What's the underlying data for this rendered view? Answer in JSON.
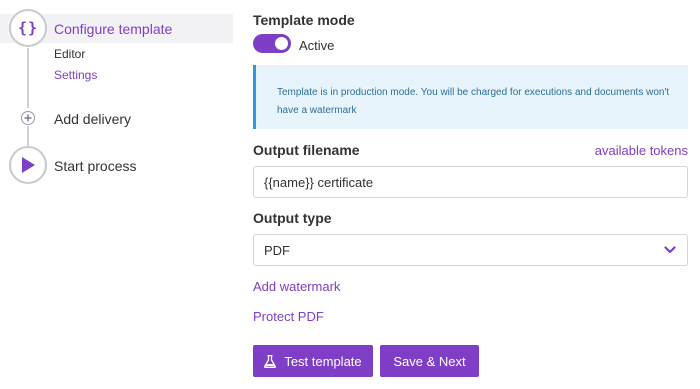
{
  "stepper": {
    "steps": [
      {
        "label": "Configure template",
        "icon": "curly-braces-icon",
        "active": true,
        "sub_items": [
          {
            "label": "Editor",
            "active": false
          },
          {
            "label": "Settings",
            "active": true
          }
        ]
      },
      {
        "label": "Add delivery",
        "icon": "plus-icon",
        "active": false
      },
      {
        "label": "Start process",
        "icon": "play-icon",
        "active": false
      }
    ]
  },
  "form": {
    "template_mode": {
      "title": "Template mode",
      "toggle_label": "Active",
      "enabled": true
    },
    "info": {
      "message": "Template is in production mode. You will be charged for executions and documents won't have a watermark"
    },
    "output_filename": {
      "title": "Output filename",
      "tokens_link": "available tokens",
      "value": "{{name}} certificate"
    },
    "output_type": {
      "title": "Output type",
      "selected": "PDF"
    },
    "add_watermark_link": "Add watermark",
    "protect_pdf_link": "Protect PDF",
    "buttons": {
      "test": "Test template",
      "save_next": "Save & Next"
    }
  },
  "colors": {
    "accent": "#7e3fc6",
    "info_bg": "#e8f4fb",
    "info_border": "#2e9ad6",
    "info_text": "#2c6f99"
  }
}
